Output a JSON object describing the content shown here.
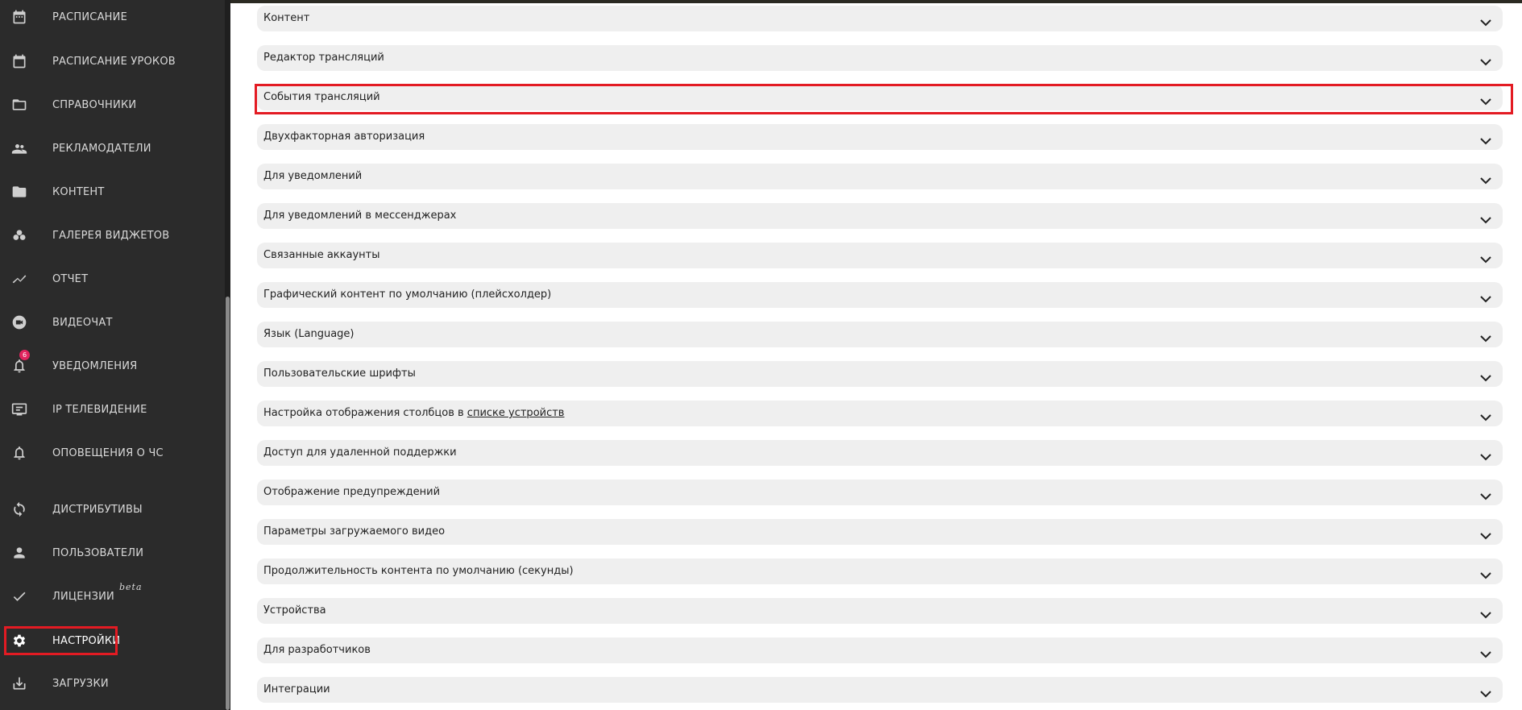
{
  "sidebar": {
    "items": [
      {
        "label": "РАСПИСАНИЕ",
        "icon": "calendar-icon"
      },
      {
        "label": "РАСПИСАНИЕ УРОКОВ",
        "icon": "calendar-blank-icon"
      },
      {
        "label": "СПРАВОЧНИКИ",
        "icon": "folder-outline-icon"
      },
      {
        "label": "РЕКЛАМОДАТЕЛИ",
        "icon": "people-icon"
      },
      {
        "label": "КОНТЕНТ",
        "icon": "folder-icon"
      },
      {
        "label": "ГАЛЕРЕЯ ВИДЖЕТОВ",
        "icon": "widgets-icon"
      },
      {
        "label": "ОТЧЕТ",
        "icon": "trend-icon"
      },
      {
        "label": "ВИДЕОЧАТ",
        "icon": "video-chat-icon"
      },
      {
        "label": "УВЕДОМЛЕНИЯ",
        "icon": "bell-icon",
        "badge": "6"
      },
      {
        "label": "IP ТЕЛЕВИДЕНИЕ",
        "icon": "tv-icon"
      },
      {
        "label": "ОПОВЕЩЕНИЯ О ЧС",
        "icon": "alert-bell-icon"
      },
      {
        "label": "ДИСТРИБУТИВЫ",
        "icon": "sync-icon"
      },
      {
        "label": "ПОЛЬЗОВАТЕЛИ",
        "icon": "user-icon"
      },
      {
        "label": "ЛИЦЕНЗИИ",
        "icon": "check-icon",
        "tag": "beta"
      },
      {
        "label": "НАСТРОЙКИ",
        "icon": "gear-icon",
        "active": true
      },
      {
        "label": "ЗАГРУЗКИ",
        "icon": "download-icon"
      }
    ]
  },
  "settings": {
    "sections": [
      "Контент",
      "Редактор трансляций",
      "События трансляций",
      "Двухфакторная авторизация",
      "Для уведомлений",
      "Для уведомлений в мессенджерах",
      "Связанные аккаунты",
      "Графический контент по умолчанию (плейсхолдер)",
      "Язык (Language)",
      "Пользовательские шрифты",
      "Настройка отображения столбцов в",
      "Доступ для удаленной поддержки",
      "Отображение предупреждений",
      "Параметры загружаемого видео",
      "Продолжительность контента по умолчанию (секунды)",
      "Устройства",
      "Для разработчиков",
      "Интеграции"
    ],
    "device_list_link": "списке устройств"
  },
  "colors": {
    "sidebar_bg": "#2b2b2b",
    "highlight": "#e31b23",
    "row_bg": "#efefef",
    "badge": "#e0245e"
  }
}
